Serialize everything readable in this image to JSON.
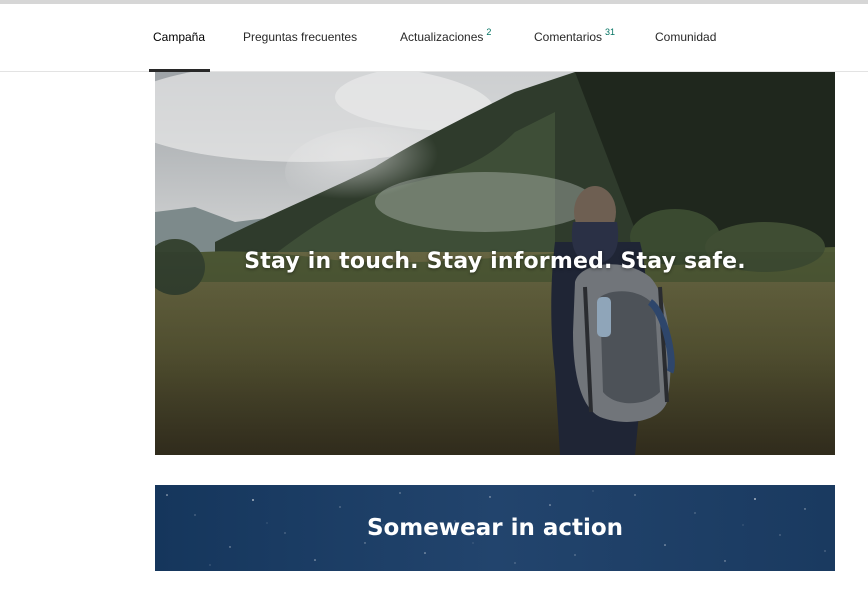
{
  "tabs": [
    {
      "label": "Campaña",
      "count": null,
      "active": true
    },
    {
      "label": "Preguntas frecuentes",
      "count": null,
      "active": false
    },
    {
      "label": "Actualizaciones",
      "count": "2",
      "active": false
    },
    {
      "label": "Comentarios",
      "count": "31",
      "active": false
    },
    {
      "label": "Comunidad",
      "count": null,
      "active": false
    }
  ],
  "hero": {
    "caption": "Stay in touch. Stay informed. Stay safe."
  },
  "banner": {
    "title": "Somewear in action"
  },
  "colors": {
    "count_accent": "#037362",
    "active_underline": "#282828",
    "banner_bg": "#1d3d63"
  }
}
